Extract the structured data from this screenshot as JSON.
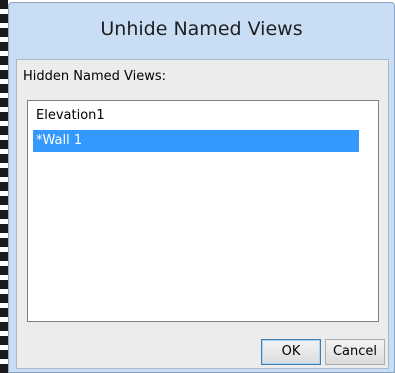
{
  "window": {
    "title": "Unhide Named Views"
  },
  "content": {
    "list_label": "Hidden Named Views:",
    "list_items": [
      {
        "label": "Elevation1",
        "selected": false
      },
      {
        "label": "*Wall 1",
        "selected": true
      }
    ]
  },
  "buttons": {
    "ok_label": "OK",
    "cancel_label": "Cancel"
  },
  "colors": {
    "selection": "#3399ff",
    "titlebar": "#c9def4"
  }
}
